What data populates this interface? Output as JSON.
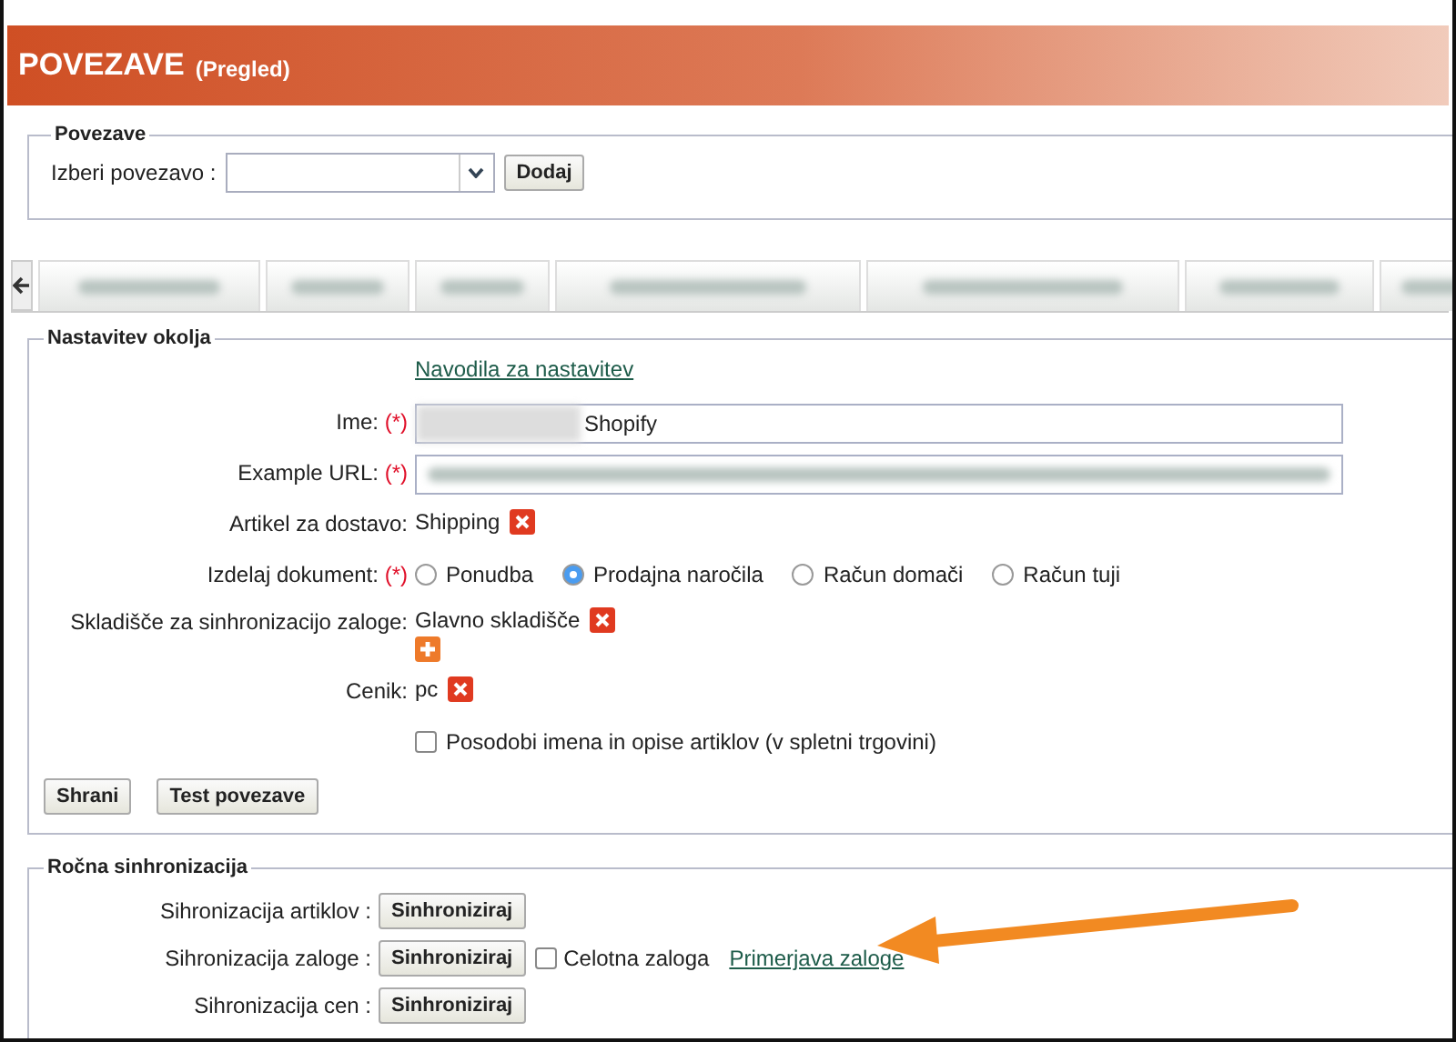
{
  "header": {
    "title": "POVEZAVE",
    "subtitle": "(Pregled)"
  },
  "connections": {
    "legend": "Povezave",
    "select_label": "Izberi povezavo :",
    "add_button": "Dodaj"
  },
  "settings": {
    "legend": "Nastavitev okolja",
    "guide_link": "Navodila za nastavitev",
    "rows": [
      {
        "kind": "input",
        "label": "Ime:",
        "required_mark": "(*)",
        "value": "Shopify"
      },
      {
        "kind": "blurred-input",
        "label": "Example URL:",
        "required_mark": "(*)"
      },
      {
        "kind": "value",
        "label": "Artikel za dostavo:",
        "value": "Shipping",
        "actions": [
          {
            "kind": "delete"
          }
        ]
      },
      {
        "kind": "radio",
        "label": "Izdelaj dokument:",
        "required_mark": "(*)",
        "options": [
          {
            "label": "Ponudba",
            "selected": false
          },
          {
            "label": "Prodajna naročila",
            "selected": true
          },
          {
            "label": "Račun domači",
            "selected": false
          },
          {
            "label": "Račun tuji",
            "selected": false
          }
        ]
      },
      {
        "kind": "value",
        "label": "Skladišče za sinhronizacijo zaloge:",
        "value": "Glavno skladišče",
        "actions": [
          {
            "kind": "delete"
          },
          {
            "kind": "add"
          }
        ]
      },
      {
        "kind": "value",
        "label": "Cenik:",
        "value": "pc",
        "actions": [
          {
            "kind": "delete"
          }
        ]
      },
      {
        "kind": "checkbox",
        "checked": false,
        "text": "Posodobi imena in opise artiklov (v spletni trgovini)"
      }
    ],
    "buttons": [
      "Shrani",
      "Test povezave"
    ]
  },
  "sync": {
    "legend": "Ročna sinhronizacija",
    "rows": [
      {
        "label": "Sihronizacija artiklov :",
        "button": "Sinhroniziraj"
      },
      {
        "label": "Sihronizacija zaloge :",
        "button": "Sinhroniziraj",
        "checkbox": {
          "label": "Celotna zaloga",
          "checked": false
        },
        "link": "Primerjava zaloge"
      },
      {
        "label": "Sihronizacija cen :",
        "button": "Sinhroniziraj"
      }
    ]
  }
}
